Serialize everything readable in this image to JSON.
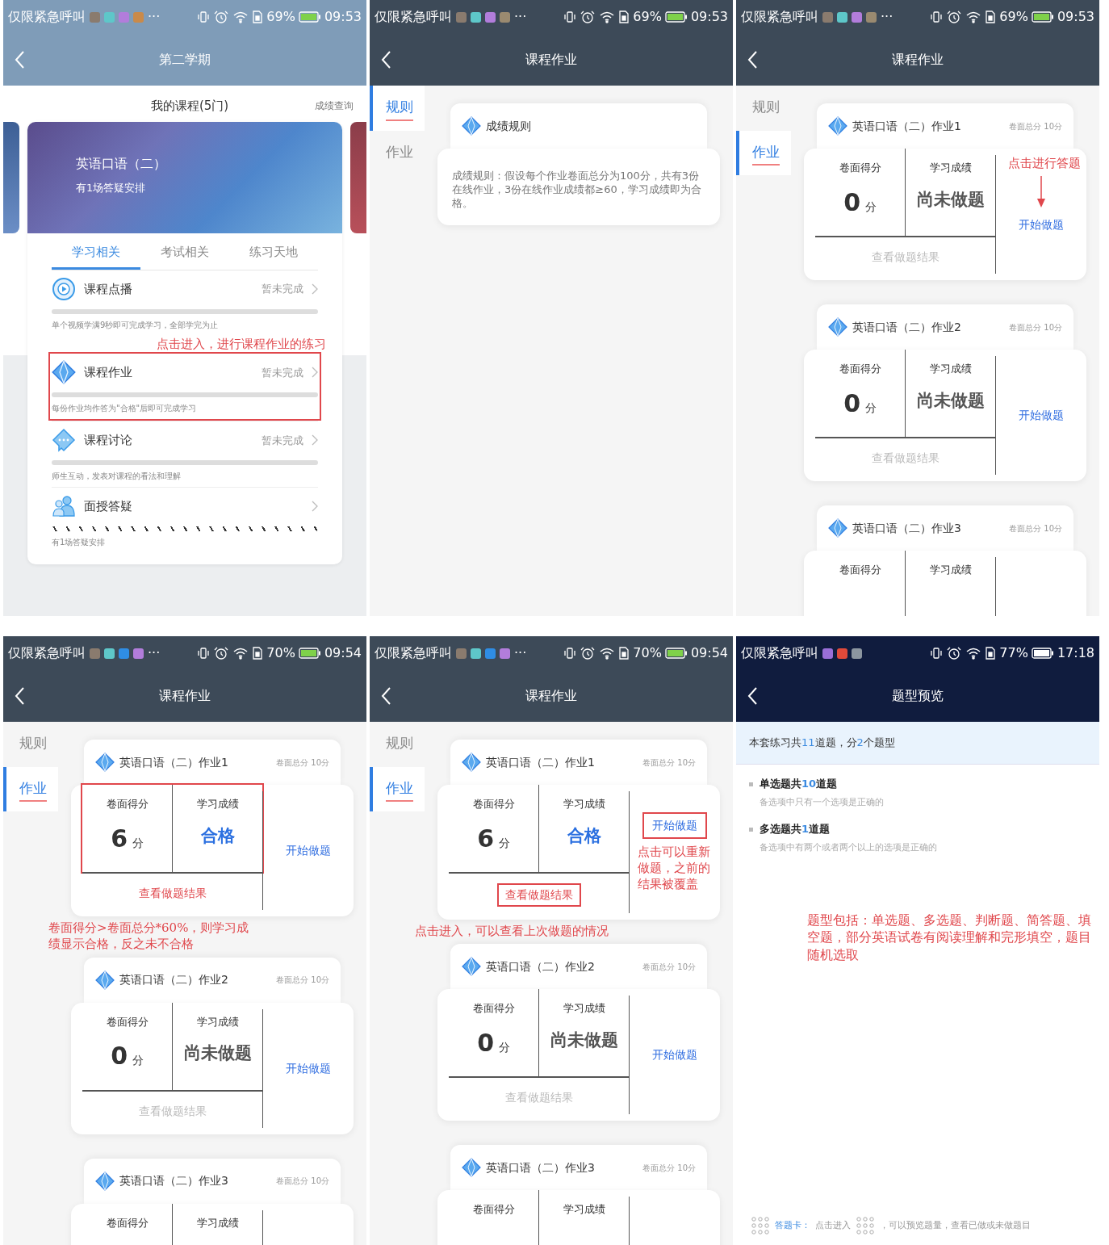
{
  "screens": [
    {
      "kind": "course",
      "status_bar": {
        "carrier": "仅限紧急呼叫",
        "app_icons": [
          {
            "color": "#8a7b6e"
          },
          {
            "color": "#5ec7c9"
          },
          {
            "color": "#b27ddb"
          },
          {
            "color": "#c98a4a"
          }
        ],
        "more": "···",
        "battery": "69%",
        "charging": true,
        "time": "09:53"
      },
      "title": "第二学期",
      "heading": "我的课程(5门)",
      "heading_link": "成绩查询",
      "banner": {
        "title": "英语口语（二）",
        "subtitle": "有1场答疑安排"
      },
      "tabs": [
        {
          "label": "学习相关",
          "selected": true
        },
        {
          "label": "考试相关",
          "selected": false
        },
        {
          "label": "练习天地",
          "selected": false
        }
      ],
      "items": [
        {
          "kind": "play",
          "title": "课程点播",
          "status": "暂未完成",
          "striped": false,
          "note": "单个视频学满9秒即可完成学习，全部学完为止",
          "highlighted": false
        },
        {
          "kind": "homework",
          "title": "课程作业",
          "status": "暂未完成",
          "striped": false,
          "note": "每份作业均作答为\"合格\"后即可完成学习",
          "highlighted": true,
          "annotation": "点击进入，进行课程作业的练习"
        },
        {
          "kind": "discussion",
          "title": "课程讨论",
          "status": "暂未完成",
          "striped": false,
          "note": "师生互动，发表对课程的看法和理解",
          "highlighted": false
        },
        {
          "kind": "qa",
          "title": "面授答疑",
          "striped": true,
          "note": "有1场答疑安排",
          "highlighted": false
        }
      ]
    },
    {
      "kind": "rules",
      "status_bar": {
        "carrier": "仅限紧急呼叫",
        "app_icons": [
          {
            "color": "#8a7b6e"
          },
          {
            "color": "#5ec7c9"
          },
          {
            "color": "#b27ddb"
          },
          {
            "color": "#9a8a70"
          }
        ],
        "more": "···",
        "battery": "69%",
        "charging": true,
        "time": "09:53"
      },
      "title": "课程作业",
      "side_tabs": [
        {
          "label": "规则",
          "selected": true
        },
        {
          "label": "作业",
          "selected": false
        }
      ],
      "rule": {
        "title": "成绩规则",
        "text": "成绩规则：假设每个作业卷面总分为100分，共有3份在线作业，3份在线作业成绩都≥60，学习成绩即为合格。"
      }
    },
    {
      "kind": "homework",
      "status_bar": {
        "carrier": "仅限紧急呼叫",
        "app_icons": [
          {
            "color": "#8a7b6e"
          },
          {
            "color": "#5ec7c9"
          },
          {
            "color": "#b27ddb"
          },
          {
            "color": "#9a8a70"
          }
        ],
        "more": "···",
        "battery": "69%",
        "charging": true,
        "time": "09:53"
      },
      "title": "课程作业",
      "side_tabs": [
        {
          "label": "规则",
          "selected": false
        },
        {
          "label": "作业",
          "selected": true
        }
      ],
      "assignments": [
        {
          "title": "英语口语（二）作业1",
          "total": "卷面总分 10分",
          "score_label": "卷面得分",
          "score": "0",
          "unit": "分",
          "grade_label": "学习成绩",
          "grade": "尚未做题",
          "passed": false,
          "start": "开始做题",
          "view": "查看做题结果",
          "has_result": false,
          "boxed_scores": false,
          "boxed_start": false,
          "boxed_view": false,
          "note_above_start": "点击进行答题"
        },
        {
          "title": "英语口语（二）作业2",
          "total": "卷面总分 10分",
          "score_label": "卷面得分",
          "score": "0",
          "unit": "分",
          "grade_label": "学习成绩",
          "grade": "尚未做题",
          "passed": false,
          "start": "开始做题",
          "view": "查看做题结果",
          "has_result": false,
          "boxed_scores": false,
          "boxed_start": false,
          "boxed_view": false
        },
        {
          "title": "英语口语（二）作业3",
          "total": "卷面总分 10分",
          "score_label": "卷面得分",
          "grade_label": "学习成绩"
        }
      ]
    },
    {
      "kind": "homework",
      "status_bar": {
        "carrier": "仅限紧急呼叫",
        "app_icons": [
          {
            "color": "#8a7b6e"
          },
          {
            "color": "#5ec7c9"
          },
          {
            "color": "#2f8de4"
          },
          {
            "color": "#b27ddb"
          }
        ],
        "more": "···",
        "battery": "70%",
        "charging": true,
        "time": "09:54"
      },
      "title": "课程作业",
      "side_tabs": [
        {
          "label": "规则",
          "selected": false
        },
        {
          "label": "作业",
          "selected": true
        }
      ],
      "assignments": [
        {
          "title": "英语口语（二）作业1",
          "total": "卷面总分 10分",
          "score_label": "卷面得分",
          "score": "6",
          "unit": "分",
          "grade_label": "学习成绩",
          "grade": "合格",
          "passed": true,
          "start": "开始做题",
          "view": "查看做题结果",
          "has_result": true,
          "boxed_scores": true,
          "boxed_start": false,
          "boxed_view": false,
          "note_below": "卷面得分>卷面总分*60%，则学习成绩显示合格，反之未不合格"
        },
        {
          "title": "英语口语（二）作业2",
          "total": "卷面总分 10分",
          "score_label": "卷面得分",
          "score": "0",
          "unit": "分",
          "grade_label": "学习成绩",
          "grade": "尚未做题",
          "passed": false,
          "start": "开始做题",
          "view": "查看做题结果",
          "has_result": false,
          "boxed_scores": false,
          "boxed_start": false,
          "boxed_view": false
        },
        {
          "title": "英语口语（二）作业3",
          "total": "卷面总分 10分",
          "score_label": "卷面得分",
          "grade_label": "学习成绩"
        }
      ]
    },
    {
      "kind": "homework",
      "status_bar": {
        "carrier": "仅限紧急呼叫",
        "app_icons": [
          {
            "color": "#8a7b6e"
          },
          {
            "color": "#5ec7c9"
          },
          {
            "color": "#2f8de4"
          },
          {
            "color": "#b27ddb"
          }
        ],
        "more": "···",
        "battery": "70%",
        "charging": true,
        "time": "09:54"
      },
      "title": "课程作业",
      "side_tabs": [
        {
          "label": "规则",
          "selected": false
        },
        {
          "label": "作业",
          "selected": true
        }
      ],
      "assignments": [
        {
          "title": "英语口语（二）作业1",
          "total": "卷面总分 10分",
          "score_label": "卷面得分",
          "score": "6",
          "unit": "分",
          "grade_label": "学习成绩",
          "grade": "合格",
          "passed": true,
          "start": "开始做题",
          "view": "查看做题结果",
          "has_result": true,
          "boxed_scores": false,
          "boxed_start": true,
          "boxed_view": true,
          "note_below_start": "点击可以重新做题，之前的结果被覆盖",
          "note_below": "点击进入，可以查看上次做题的情况"
        },
        {
          "title": "英语口语（二）作业2",
          "total": "卷面总分 10分",
          "score_label": "卷面得分",
          "score": "0",
          "unit": "分",
          "grade_label": "学习成绩",
          "grade": "尚未做题",
          "passed": false,
          "start": "开始做题",
          "view": "查看做题结果",
          "has_result": false,
          "boxed_scores": false,
          "boxed_start": false,
          "boxed_view": false
        },
        {
          "title": "英语口语（二）作业3",
          "total": "卷面总分 10分",
          "score_label": "卷面得分",
          "grade_label": "学习成绩"
        }
      ]
    },
    {
      "kind": "preview",
      "status_bar": {
        "carrier": "仅限紧急呼叫",
        "app_icons": [
          {
            "color": "#9a6fd8"
          },
          {
            "color": "#e04a3a"
          },
          {
            "color": "#8c96a0"
          }
        ],
        "battery": "77%",
        "charging": false,
        "time": "17:18"
      },
      "title": "题型预览",
      "summary": [
        {
          "text": "本套练习共",
          "kind": "plain"
        },
        {
          "text": "11",
          "kind": "count"
        },
        {
          "text": "道题，分",
          "kind": "plain"
        },
        {
          "text": "2",
          "kind": "count"
        },
        {
          "text": "个题型",
          "kind": "plain"
        }
      ],
      "types": [
        {
          "parts": [
            {
              "text": "单选题共",
              "kind": "plain"
            },
            {
              "text": "10",
              "kind": "count"
            },
            {
              "text": "道题",
              "kind": "plain"
            }
          ],
          "description": "备选项中只有一个选项是正确的"
        },
        {
          "parts": [
            {
              "text": "多选题共",
              "kind": "plain"
            },
            {
              "text": "1",
              "kind": "count"
            },
            {
              "text": "道题",
              "kind": "plain"
            }
          ],
          "description": "备选项中有两个或者两个以上的选项是正确的"
        }
      ],
      "annotation": "题型包括：单选题、多选题、判断题、简答题、填空题，部分英语试卷有阅读理解和完形填空，题目随机选取",
      "footer": {
        "label": "答题卡：",
        "before_icon": "点击进入",
        "after_icon": "，可以预览题量，查看已做或未做题目"
      }
    }
  ]
}
